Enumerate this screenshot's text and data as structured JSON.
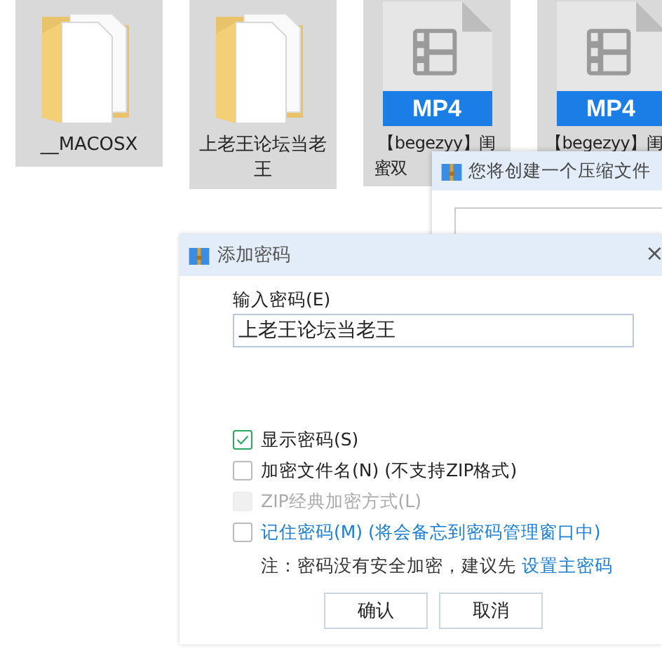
{
  "files": [
    {
      "kind": "folder",
      "label_lines": [
        "__MACOSX"
      ],
      "selected": true
    },
    {
      "kind": "folder",
      "label_lines": [
        "上老王论坛当老",
        "王"
      ],
      "selected": true
    },
    {
      "kind": "mp4",
      "badge": "MP4",
      "label_lines": [
        "【begezyy】闺",
        "蜜双"
      ],
      "selected": true
    },
    {
      "kind": "mp4",
      "badge": "MP4",
      "label_lines": [
        "【begezyy】闺"
      ],
      "selected": true
    }
  ],
  "back_window": {
    "title": "您将创建一个压缩文件"
  },
  "dialog": {
    "title": "添加密码",
    "close": "×",
    "password_label": "输入密码(E)",
    "password_value": "上老王论坛当老王",
    "options": [
      {
        "label": "显示密码(S)",
        "checked": true,
        "disabled": false,
        "link": false
      },
      {
        "label": "加密文件名(N) (不支持ZIP格式)",
        "checked": false,
        "disabled": false,
        "link": false
      },
      {
        "label": "ZIP经典加密方式(L)",
        "checked": false,
        "disabled": true,
        "link": false
      },
      {
        "label": "记住密码(M) (将会备忘到密码管理窗口中)",
        "checked": false,
        "disabled": false,
        "link": true
      }
    ],
    "note": "注：密码没有安全加密，建议先 ",
    "note_link": "设置主密码",
    "buttons": [
      "确认",
      "取消"
    ]
  }
}
